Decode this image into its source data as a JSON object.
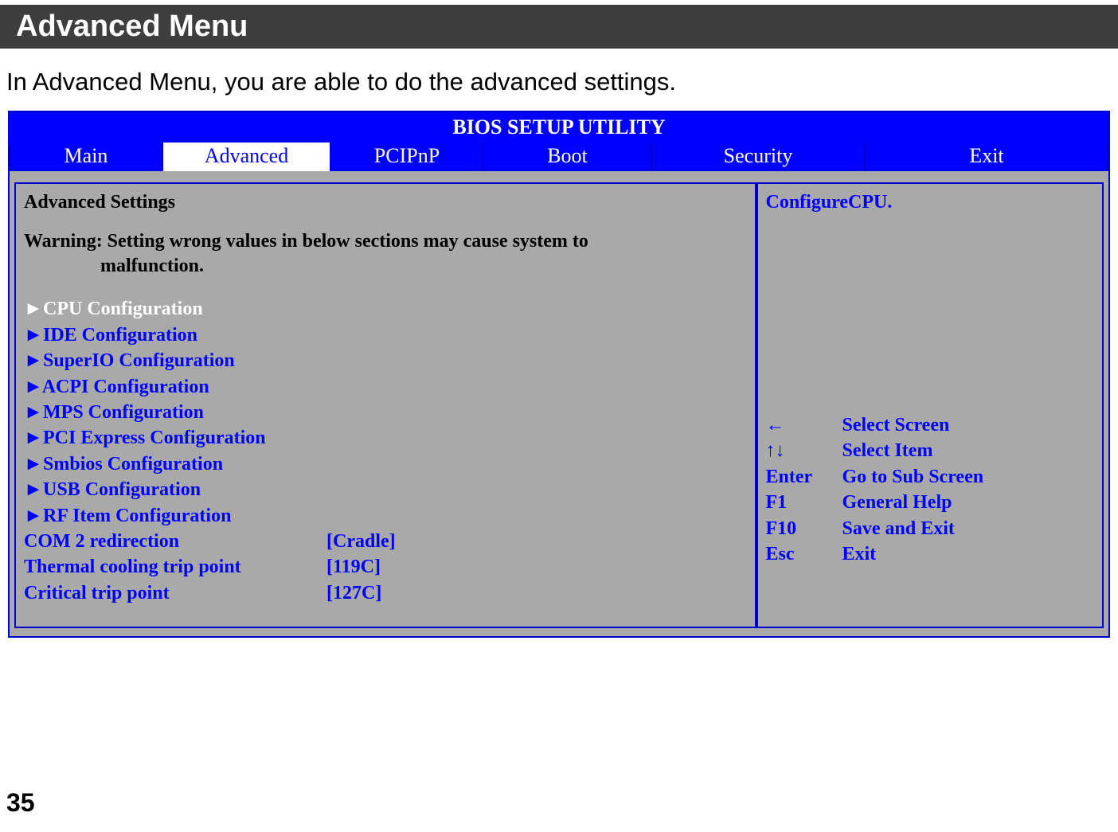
{
  "header": {
    "title": "Advanced Menu"
  },
  "description": "In Advanced Menu, you are able to do the advanced settings.",
  "bios": {
    "title": "BIOS SETUP UTILITY",
    "tabs": {
      "main": "Main",
      "advanced": "Advanced",
      "pcipnp": "PCIPnP",
      "boot": "Boot",
      "security": "Security",
      "exit": "Exit"
    },
    "left": {
      "title": "Advanced Settings",
      "warning_line1": "Warning: Setting wrong values in below sections may cause system to",
      "warning_line2": "malfunction.",
      "submenus": [
        "CPU Configuration",
        "IDE Configuration",
        "SuperIO Configuration",
        "ACPI Configuration",
        "MPS Configuration",
        "PCI Express Configuration",
        "Smbios Configuration",
        "USB Configuration",
        "RF Item Configuration"
      ],
      "settings": [
        {
          "label": "COM 2 redirection",
          "value": "[Cradle]"
        },
        {
          "label": "Thermal cooling trip point",
          "value": "[119C]"
        },
        {
          "label": "Critical trip point",
          "value": "[127C]"
        }
      ]
    },
    "right": {
      "title": "ConfigureCPU.",
      "help": [
        {
          "key": "←",
          "action": "Select Screen"
        },
        {
          "key": "↑↓",
          "action": "Select Item"
        },
        {
          "key": "Enter",
          "action": "Go to Sub Screen"
        },
        {
          "key": "F1",
          "action": "General Help"
        },
        {
          "key": "F10",
          "action": "Save and Exit"
        },
        {
          "key": "Esc",
          "action": "Exit"
        }
      ]
    }
  },
  "page_number": "35"
}
